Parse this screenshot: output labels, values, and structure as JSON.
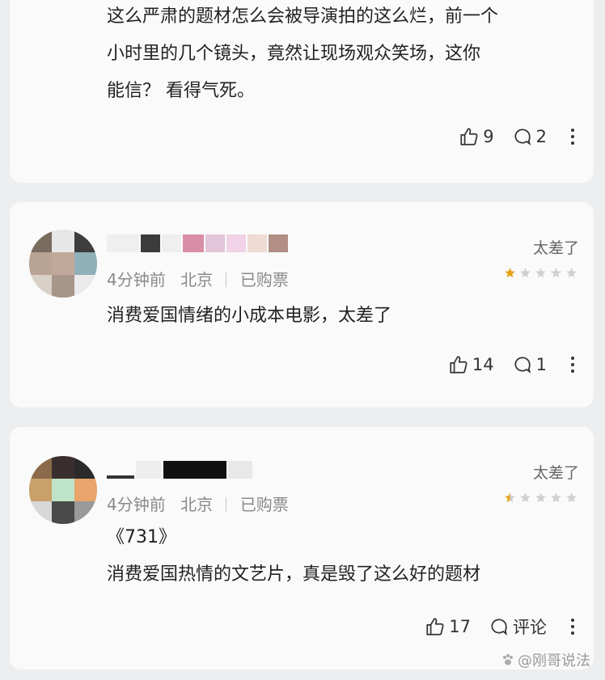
{
  "comments": [
    {
      "lines": [
        "这么严肃的题材怎么会被导演拍的这么烂，前一个",
        "小时里的几个镜头，竟然让现场观众笑场，这你",
        "能信？ 看得气死。"
      ],
      "likes": "9",
      "replies": "2"
    },
    {
      "rating_text": "太差了",
      "rating_stars": 1,
      "time": "4分钟前",
      "location": "北京",
      "ticket": "已购票",
      "lines": [
        "消费爱国情绪的小成本电影，太差了"
      ],
      "likes": "14",
      "replies": "1"
    },
    {
      "rating_text": "太差了",
      "rating_stars": 0.5,
      "time": "4分钟前",
      "location": "北京",
      "ticket": "已购票",
      "lines": [
        "《731》",
        "消费爱国热情的文艺片，真是毁了这么好的题材"
      ],
      "likes": "17",
      "replies": "评论"
    }
  ],
  "watermark": "@刚哥说法",
  "colors": {
    "star_filled": "#e8a21a",
    "star_empty": "#d0d0d0",
    "background": "#eceef0",
    "card": "#fafafa"
  }
}
